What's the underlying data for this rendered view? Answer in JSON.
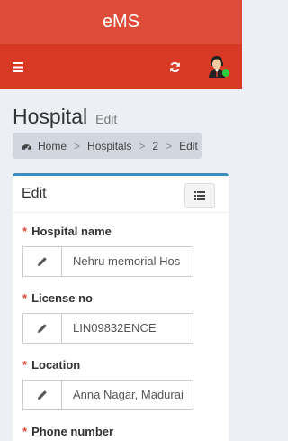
{
  "app": {
    "brand": "eMS"
  },
  "navbar": {
    "menu_icon": "hamburger-icon",
    "refresh_icon": "refresh-icon",
    "avatar_icon": "user-avatar-icon",
    "status_color": "#2ecc40"
  },
  "page": {
    "title": "Hospital",
    "subtitle": "Edit"
  },
  "breadcrumb": {
    "home_icon": "dashboard-icon",
    "items": [
      "Home",
      "Hospitals",
      "2",
      "Edit"
    ],
    "separator": ">"
  },
  "form": {
    "title": "Edit",
    "list_button_icon": "list-icon",
    "required_marker": "*",
    "fields": [
      {
        "label": "Hospital name",
        "value": "Nehru memorial Hos",
        "icon": "pencil-icon"
      },
      {
        "label": "License no",
        "value": "LIN09832ENCE",
        "icon": "pencil-icon"
      },
      {
        "label": "Location",
        "value": "Anna Nagar, Madurai",
        "icon": "pencil-icon"
      },
      {
        "label": "Phone number",
        "value": "",
        "icon": "pencil-icon"
      }
    ]
  },
  "colors": {
    "header": "#dd4b39",
    "navbar": "#d73925",
    "box_accent": "#3c8dbc",
    "required": "#dd4b39"
  }
}
